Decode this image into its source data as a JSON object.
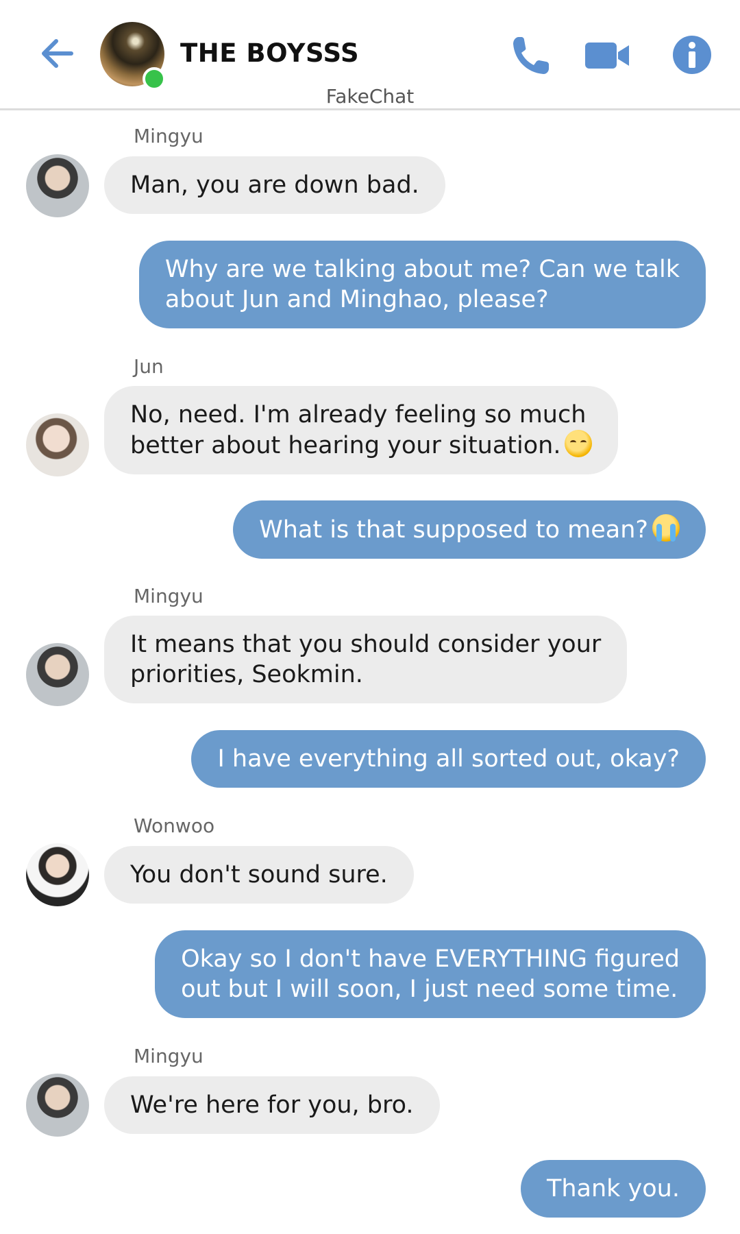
{
  "header": {
    "title": "THE BOYSSS",
    "subtitle": "FakeChat",
    "icons": {
      "back": "back-arrow-icon",
      "call": "phone-icon",
      "video": "video-camera-icon",
      "info": "info-icon"
    },
    "accent_color": "#5b8fd0",
    "online_color": "#37c24a"
  },
  "messages": [
    {
      "sender": "Mingyu",
      "text": "Man, you are down bad."
    },
    {
      "text": "Why are we talking about me? Can we talk\nabout Jun and Minghao, please?"
    },
    {
      "sender": "Jun",
      "text": "No, need. I'm already feeling so much\nbetter about hearing your situation."
    },
    {
      "text": "What is that supposed to mean?"
    },
    {
      "sender": "Mingyu",
      "text": "It means that you should consider your\npriorities, Seokmin."
    },
    {
      "text": "I have everything all sorted out, okay?"
    },
    {
      "sender": "Wonwoo",
      "text": "You don't sound sure."
    },
    {
      "text": "Okay so I don't have EVERYTHING figured\nout but I will soon, I just need some time."
    },
    {
      "sender": "Mingyu",
      "text": "We're here for you, bro."
    },
    {
      "text": "Thank you."
    }
  ],
  "emojis": {
    "blush": "smiling-face-with-smiling-eyes-emoji",
    "cry": "loudly-crying-face-emoji"
  },
  "colors": {
    "incoming_bubble": "#ececec",
    "outgoing_bubble": "#6b9bcc"
  }
}
